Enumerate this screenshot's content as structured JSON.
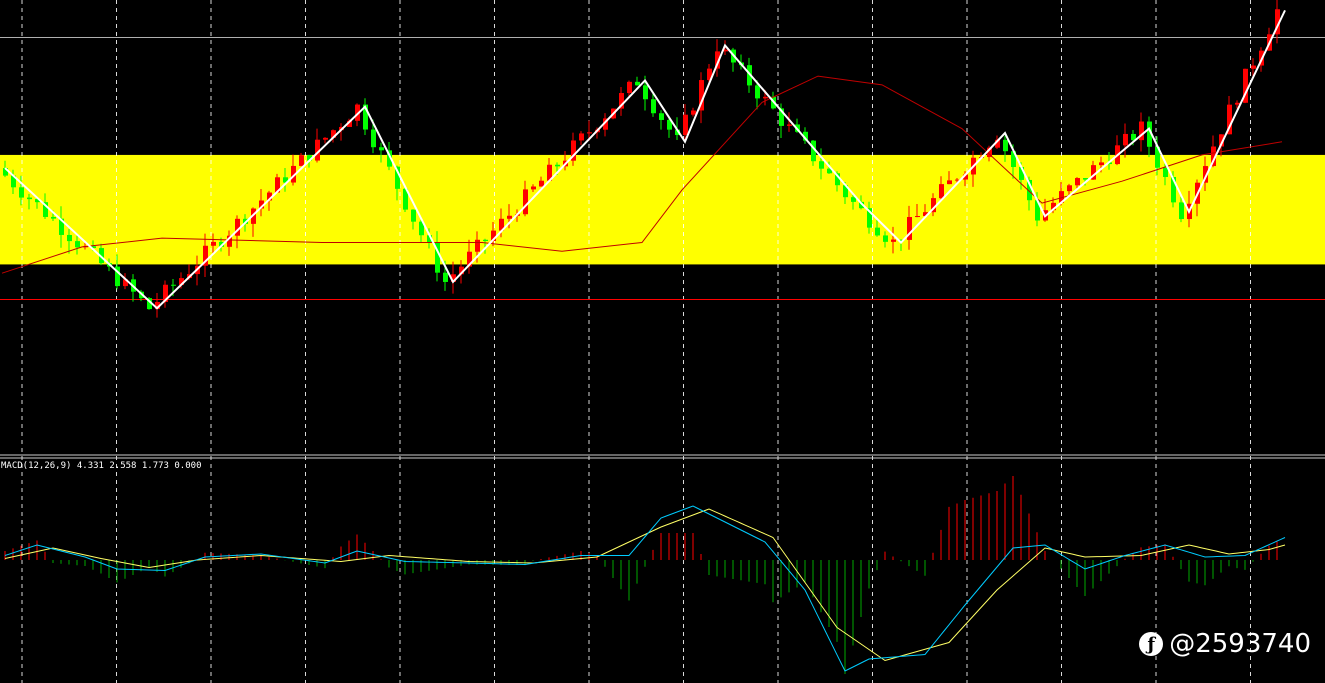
{
  "watermark": {
    "icon": "feather-icon",
    "text": "@2593740"
  },
  "chart_data": [
    {
      "type": "candlestick",
      "bars": 160,
      "bull_color": "#FF0000",
      "bear_color": "#00FF00",
      "ma_color": "#C00000",
      "zigzag_color": "#FFFFFF",
      "zone_color": "#FFFF00",
      "ylim": [
        0,
        100
      ],
      "zone": [
        41,
        66
      ],
      "hlines": [
        {
          "value": 92.8,
          "color": "#B0B0B0"
        },
        {
          "value": 33,
          "color": "#FF0000"
        }
      ],
      "zigzag": [
        [
          0,
          63
        ],
        [
          19,
          31
        ],
        [
          45,
          77
        ],
        [
          56,
          37
        ],
        [
          80,
          83
        ],
        [
          85,
          69
        ],
        [
          90,
          91
        ],
        [
          107,
          55
        ],
        [
          112,
          46
        ],
        [
          125,
          71
        ],
        [
          130,
          52
        ],
        [
          143,
          72
        ],
        [
          148,
          53
        ],
        [
          160,
          99
        ]
      ],
      "ma": [
        [
          0,
          39
        ],
        [
          10,
          45
        ],
        [
          20,
          47
        ],
        [
          40,
          46
        ],
        [
          60,
          46
        ],
        [
          70,
          44
        ],
        [
          80,
          46
        ],
        [
          85,
          58
        ],
        [
          95,
          78
        ],
        [
          102,
          84
        ],
        [
          110,
          82
        ],
        [
          120,
          72
        ],
        [
          130,
          55
        ],
        [
          140,
          60
        ],
        [
          150,
          66
        ],
        [
          160,
          69
        ]
      ],
      "closes_per_zigzag_leg": 20
    },
    {
      "type": "macd",
      "label": "MACD(12,26,9) 4.331 2.558 1.773 0.000",
      "ylim": [
        -8,
        6
      ],
      "histogram_color_up": "#FF0000",
      "histogram_color_down": "#00AA00",
      "macd_color": "#00CCFF",
      "signal_color": "#FFFF66",
      "macd": [
        [
          0,
          0.3
        ],
        [
          4,
          1.0
        ],
        [
          10,
          0.2
        ],
        [
          14,
          -0.6
        ],
        [
          20,
          -0.7
        ],
        [
          25,
          0.2
        ],
        [
          32,
          0.4
        ],
        [
          40,
          -0.2
        ],
        [
          44,
          0.6
        ],
        [
          50,
          -0.1
        ],
        [
          58,
          -0.2
        ],
        [
          65,
          -0.3
        ],
        [
          72,
          0.3
        ],
        [
          78,
          0.3
        ],
        [
          82,
          2.8
        ],
        [
          86,
          3.6
        ],
        [
          95,
          1.2
        ],
        [
          100,
          -2.0
        ],
        [
          105,
          -7.4
        ],
        [
          108,
          -6.6
        ],
        [
          115,
          -6.3
        ],
        [
          120,
          -3.0
        ],
        [
          126,
          0.8
        ],
        [
          130,
          1.0
        ],
        [
          135,
          -0.6
        ],
        [
          140,
          0.3
        ],
        [
          145,
          1.0
        ],
        [
          150,
          0.2
        ],
        [
          155,
          0.3
        ],
        [
          160,
          1.5
        ]
      ],
      "signal": [
        [
          0,
          0.1
        ],
        [
          6,
          0.8
        ],
        [
          12,
          0.1
        ],
        [
          18,
          -0.5
        ],
        [
          24,
          0.0
        ],
        [
          32,
          0.3
        ],
        [
          42,
          -0.1
        ],
        [
          48,
          0.3
        ],
        [
          58,
          -0.1
        ],
        [
          66,
          -0.2
        ],
        [
          74,
          0.2
        ],
        [
          82,
          2.2
        ],
        [
          88,
          3.4
        ],
        [
          96,
          1.5
        ],
        [
          104,
          -4.5
        ],
        [
          110,
          -6.7
        ],
        [
          118,
          -5.5
        ],
        [
          124,
          -2.0
        ],
        [
          130,
          0.8
        ],
        [
          135,
          0.2
        ],
        [
          142,
          0.3
        ],
        [
          148,
          1.0
        ],
        [
          153,
          0.4
        ],
        [
          158,
          0.7
        ],
        [
          160,
          1.0
        ]
      ]
    }
  ]
}
